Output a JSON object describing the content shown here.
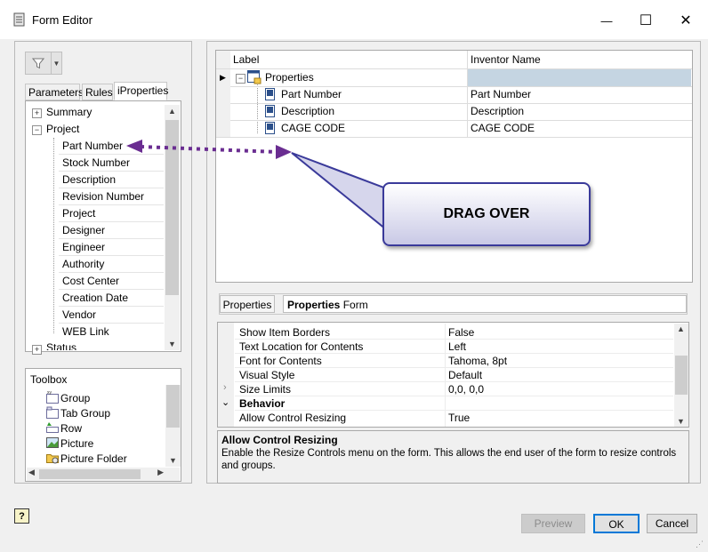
{
  "window": {
    "title": "Form Editor",
    "minimize_glyph": "—",
    "maximize_glyph": "☐",
    "close_glyph": "✕"
  },
  "left": {
    "filter_icon": "filter-icon",
    "tabs": [
      {
        "label": "Parameters",
        "active": false
      },
      {
        "label": "Rules",
        "active": false
      },
      {
        "label": "iProperties",
        "active": true
      }
    ],
    "tree": {
      "summary": "Summary",
      "project": "Project",
      "items": [
        "Part Number",
        "Stock Number",
        "Description",
        "Revision Number",
        "Project",
        "Designer",
        "Engineer",
        "Authority",
        "Cost Center",
        "Creation Date",
        "Vendor",
        "WEB Link"
      ],
      "status": "Status"
    },
    "toolbox": {
      "title": "Toolbox",
      "items": [
        "Group",
        "Tab Group",
        "Row",
        "Picture",
        "Picture Folder"
      ]
    }
  },
  "grid": {
    "col_label": "Label",
    "col_inventor": "Inventor Name",
    "root": "Properties",
    "rows": [
      {
        "label": "Part Number",
        "inventor": "Part Number"
      },
      {
        "label": "Description",
        "inventor": "Description"
      },
      {
        "label": "CAGE CODE",
        "inventor": "CAGE CODE"
      }
    ]
  },
  "callout": {
    "text": "DRAG OVER",
    "accent": "#6a2d91"
  },
  "properties": {
    "tab1": "Properties",
    "tab2_bold": "Properties",
    "tab2_rest": " Form",
    "rows": [
      {
        "name": "Show Item Borders",
        "value": "False"
      },
      {
        "name": "Text Location for Contents",
        "value": "Left"
      },
      {
        "name": "Font for Contents",
        "value": "Tahoma, 8pt"
      },
      {
        "name": "Visual Style",
        "value": "Default"
      },
      {
        "name": "Size Limits",
        "value": "0,0, 0,0"
      }
    ],
    "section": "Behavior",
    "last_row": {
      "name": "Allow Control Resizing",
      "value": "True"
    },
    "desc_title": "Allow Control Resizing",
    "desc_text": "Enable the Resize Controls menu on the form.  This allows the end user of the form to resize controls and groups."
  },
  "buttons": {
    "help": "?",
    "preview": "Preview",
    "ok": "OK",
    "cancel": "Cancel"
  }
}
